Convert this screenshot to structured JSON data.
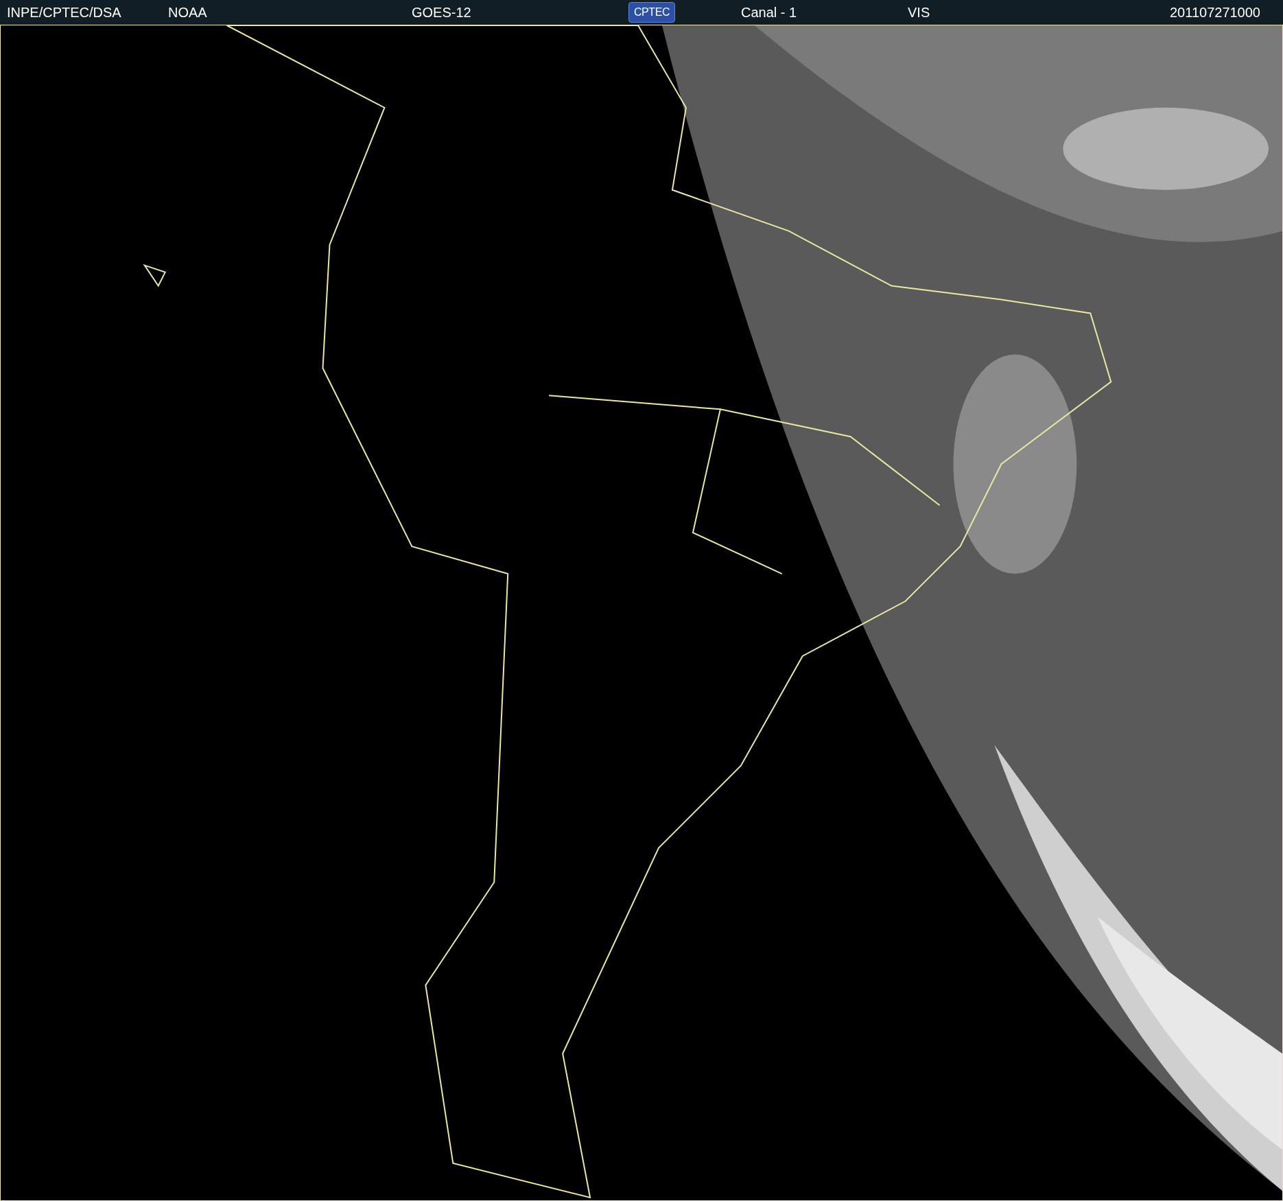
{
  "header": {
    "items": [
      {
        "kind": "text",
        "label": "INPE/CPTEC/DSA"
      },
      {
        "kind": "text",
        "label": "NOAA"
      },
      {
        "kind": "text",
        "label": "GOES-12"
      },
      {
        "kind": "logo",
        "label": "CPTEC"
      },
      {
        "kind": "text",
        "label": "Canal - 1"
      },
      {
        "kind": "text",
        "label": "VIS"
      },
      {
        "kind": "text",
        "label": "201107271000"
      }
    ]
  }
}
